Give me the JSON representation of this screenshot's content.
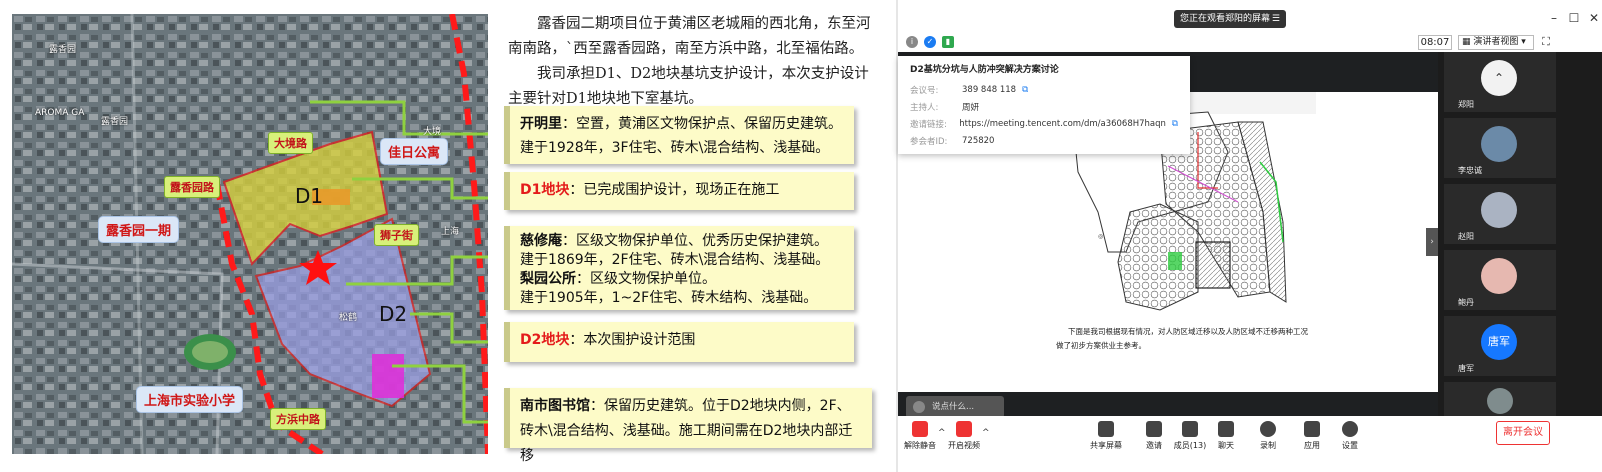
{
  "slide": {
    "intro_p1": "露香园二期项目位于黄浦区老城厢的西北角，东至河南南路，`西至露香园路，南至方浜中路，北至福佑路。",
    "intro_p2": "我司承担D1、D2地块基坑支护设计，本次支护设计主要针对D1地块地下室基坑。",
    "map_labels": {
      "dajing_road": "大境路",
      "jiari_apartment": "佳日公寓",
      "luxiangyuan_road": "露香园路",
      "d1": "D1",
      "shizi_street": "狮子街",
      "luxiangyuan_phase1": "露香园一期",
      "d2": "D2",
      "shanghai_school": "上海市实验小学",
      "fangbang_road": "方浜中路",
      "luxiangyuan_small": "露香园",
      "aroma_label": "AROMA GA",
      "dajing_small": "大境",
      "songhe_small": "松鹤",
      "shanghai_small": "上海",
      "school_small": "实验小学"
    },
    "boxes": [
      {
        "key": "开明里",
        "sep": "：",
        "text": "空置，黄浦区文物保护点、保留历史建筑。",
        "line2": "建于1928年，3F住宅、砖木\\混合结构、浅基础。",
        "red": false
      },
      {
        "key": "D1地块",
        "sep": "：",
        "text": "已完成围护设计，现场正在施工",
        "line2": "",
        "red": true
      },
      {
        "key": "慈修庵",
        "sep": "：",
        "text": "区级文物保护单位、优秀历史保护建筑。",
        "line2": "建于1869年，2F住宅、砖木\\混合结构、浅基础。",
        "key2": "梨园公所",
        "text2": "区级文物保护单位。",
        "line3": "建于1905年，1~2F住宅、砖木结构、浅基础。",
        "red": false
      },
      {
        "key": "D2地块",
        "sep": "：",
        "text": "本次围护设计范围",
        "line2": "",
        "red": true
      },
      {
        "key": "南市图书馆",
        "sep": "：",
        "text": "保留历史建筑。位于D2地块内侧，2F、砖木\\混合结构、浅基础。施工期间需在D2地块内部迁移",
        "line2": "",
        "red": false
      }
    ],
    "colors": {
      "accent_red": "#e41b1b",
      "box_bg": "#fdfbc8",
      "arrow_green": "#8fd13f",
      "d1_fill": "#d9d23c",
      "d2_fill": "#9b9fe6"
    }
  },
  "meeting": {
    "share_badge": "您正在观看郑阳的屏幕",
    "time": "08:07",
    "view_mode": "演讲者视图",
    "info": {
      "title": "D2基坑分坑与人防冲突解决方案讨论",
      "rows": [
        {
          "label": "会议号:",
          "value": "389 848 118"
        },
        {
          "label": "主持人:",
          "value": "周妍"
        },
        {
          "label": "邀请链接:",
          "value": "https://meeting.tencent.com/dm/a36068H7haqn"
        },
        {
          "label": "参会者ID:",
          "value": "725820"
        }
      ]
    },
    "chat_placeholder": "说点什么...",
    "doc_caption_1": "下面是我司根据现有情况，对人防区域迁移以及人防区域不迁移两种工况",
    "doc_caption_2": "做了初步方案供业主参考。",
    "participants": [
      {
        "name": "郑阳",
        "avatar_color": "#f2f2f2"
      },
      {
        "name": "李忠诚",
        "avatar_color": "#6b8aa8"
      },
      {
        "name": "赵阳",
        "avatar_color": "#aab3c2"
      },
      {
        "name": "鲍丹",
        "avatar_color": "#e6b8b0"
      },
      {
        "name": "唐军",
        "avatar_color": "#1678ff",
        "initials": "唐军"
      }
    ],
    "toolbar": {
      "mute": "解除静音",
      "video": "开启视频",
      "share": "共享屏幕",
      "invite": "邀请",
      "members": "成员(13)",
      "chat": "聊天",
      "record": "录制",
      "apps": "应用",
      "settings": "设置",
      "leave": "离开会议"
    }
  }
}
